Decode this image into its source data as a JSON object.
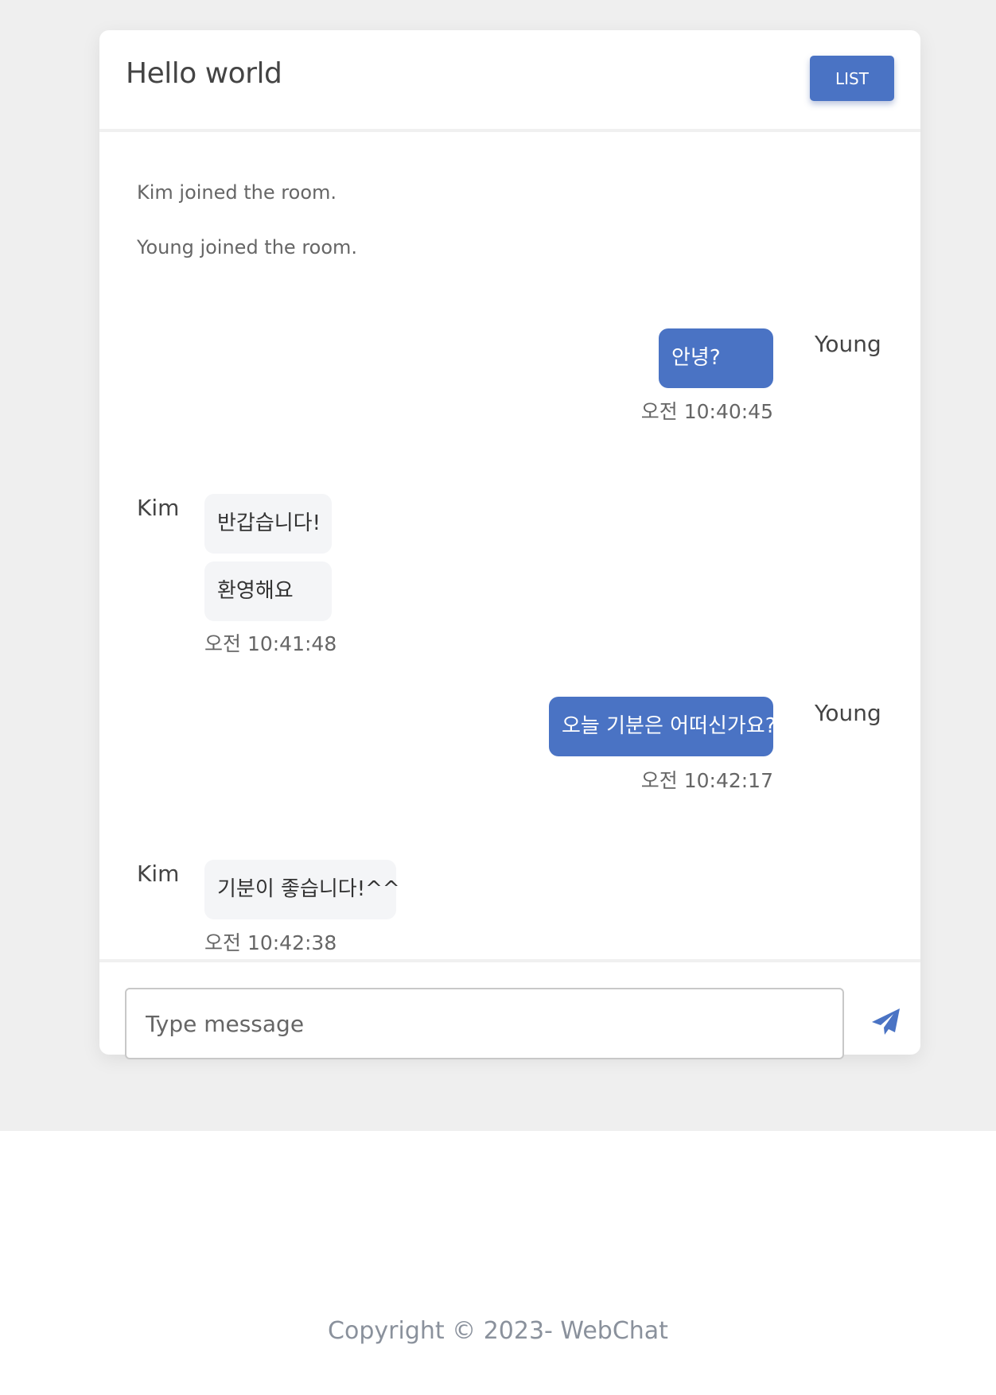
{
  "header": {
    "title": "Hello world",
    "list_label": "LIST"
  },
  "system_messages": [
    "Kim joined the room.",
    "Young joined the room."
  ],
  "messages": [
    {
      "sender": "Young",
      "texts": [
        "안녕?"
      ],
      "time": "오전 10:40:45"
    },
    {
      "sender": "Kim",
      "texts": [
        "반갑습니다!",
        "환영해요"
      ],
      "time": "오전 10:41:48"
    },
    {
      "sender": "Young",
      "texts": [
        "오늘 기분은 어떠신가요?"
      ],
      "time": "오전 10:42:17"
    },
    {
      "sender": "Kim",
      "texts": [
        "기분이 좋습니다!^^"
      ],
      "time": "오전 10:42:38"
    }
  ],
  "composer": {
    "placeholder": "Type message",
    "send_icon": "paper-plane-icon"
  },
  "footer": {
    "copyright": "Copyright © 2023- WebChat"
  },
  "colors": {
    "accent": "#4a73c4",
    "background": "#efefef",
    "bubble_theirs": "#f4f5f7"
  }
}
